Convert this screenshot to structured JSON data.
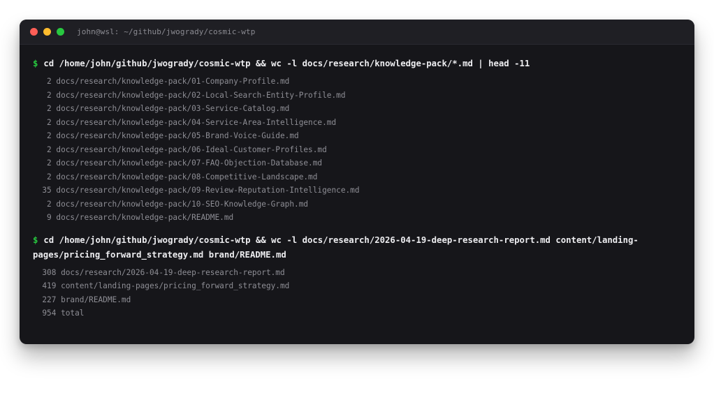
{
  "window": {
    "title": "john@wsl: ~/github/jwogrady/cosmic-wtp",
    "buttons": [
      {
        "name": "close-button",
        "color": "#ff5f57"
      },
      {
        "name": "minimize-button",
        "color": "#febc2e"
      },
      {
        "name": "maximize-button",
        "color": "#28c840"
      }
    ]
  },
  "terminal": {
    "prompt_symbol": "$",
    "blocks": [
      {
        "command_lines": [
          "cd /home/john/github/jwogrady/cosmic-wtp && wc -l docs/research/knowledge-pack/*.md | head -11"
        ],
        "output": [
          "   2 docs/research/knowledge-pack/01-Company-Profile.md",
          "   2 docs/research/knowledge-pack/02-Local-Search-Entity-Profile.md",
          "   2 docs/research/knowledge-pack/03-Service-Catalog.md",
          "   2 docs/research/knowledge-pack/04-Service-Area-Intelligence.md",
          "   2 docs/research/knowledge-pack/05-Brand-Voice-Guide.md",
          "   2 docs/research/knowledge-pack/06-Ideal-Customer-Profiles.md",
          "   2 docs/research/knowledge-pack/07-FAQ-Objection-Database.md",
          "   2 docs/research/knowledge-pack/08-Competitive-Landscape.md",
          "  35 docs/research/knowledge-pack/09-Review-Reputation-Intelligence.md",
          "   2 docs/research/knowledge-pack/10-SEO-Knowledge-Graph.md",
          "   9 docs/research/knowledge-pack/README.md"
        ]
      },
      {
        "command_lines": [
          "cd /home/john/github/jwogrady/cosmic-wtp && wc -l docs/research/2026-04-19-deep-research-report.md content/landing-",
          "pages/pricing_forward_strategy.md brand/README.md"
        ],
        "output": [
          "  308 docs/research/2026-04-19-deep-research-report.md",
          "  419 content/landing-pages/pricing_forward_strategy.md",
          "  227 brand/README.md",
          "  954 total"
        ]
      }
    ]
  }
}
